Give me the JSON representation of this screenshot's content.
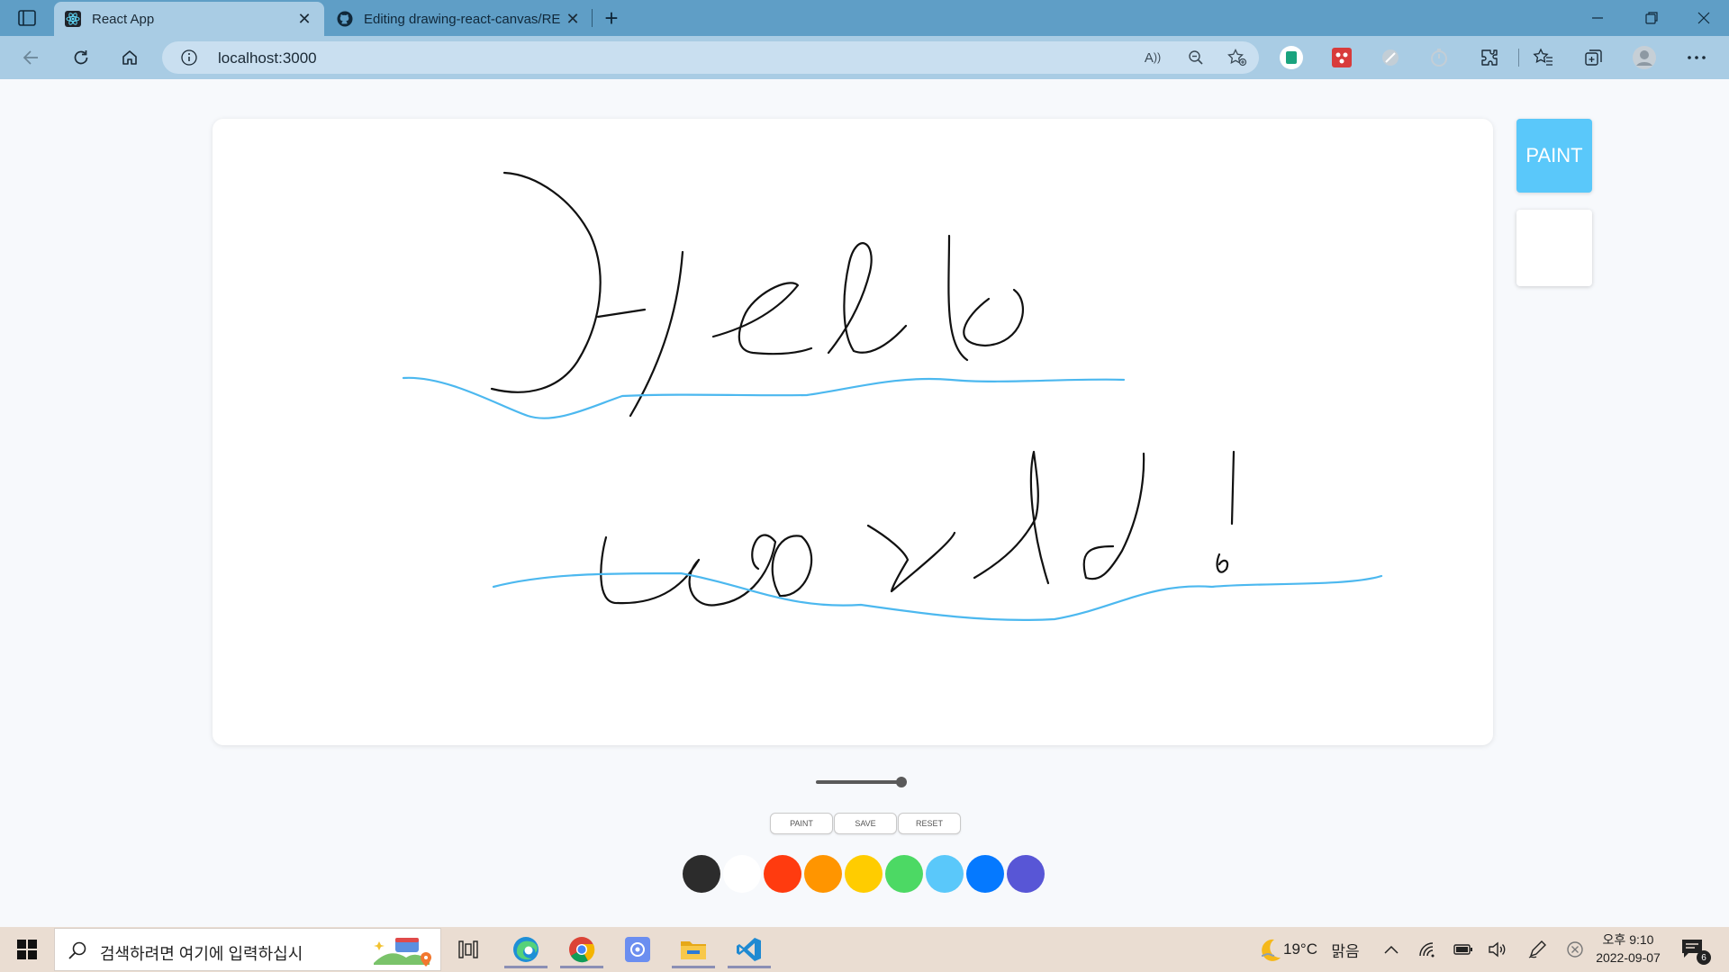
{
  "browser": {
    "tabs": [
      {
        "title": "React App",
        "active": true,
        "favicon": "react-icon"
      },
      {
        "title": "Editing drawing-react-canvas/RE",
        "active": false,
        "favicon": "github-icon"
      }
    ],
    "new_tab_label": "+",
    "url": "localhost:3000"
  },
  "canvas": {
    "background": "#ffffff",
    "stroke_black": "#111111",
    "stroke_blue": "#4cb8ef"
  },
  "sidebar": {
    "paint_label": "PAINT",
    "paint_color": "#5ac8fa"
  },
  "controls": {
    "brush_size_fraction": 0.95,
    "buttons": [
      {
        "label": "PAINT"
      },
      {
        "label": "SAVE"
      },
      {
        "label": "RESET"
      }
    ],
    "palette": [
      "#2c2c2c",
      "#ffffff",
      "#ff3b0f",
      "#ff9500",
      "#ffcc00",
      "#4cd964",
      "#5ac8fa",
      "#0579ff",
      "#5856d6"
    ]
  },
  "taskbar": {
    "search_placeholder": "검색하려면 여기에 입력하십시",
    "weather_temp": "19°C",
    "weather_desc": "맑음",
    "clock_time": "오후 9:10",
    "clock_date": "2022-09-07",
    "notification_count": "6"
  }
}
